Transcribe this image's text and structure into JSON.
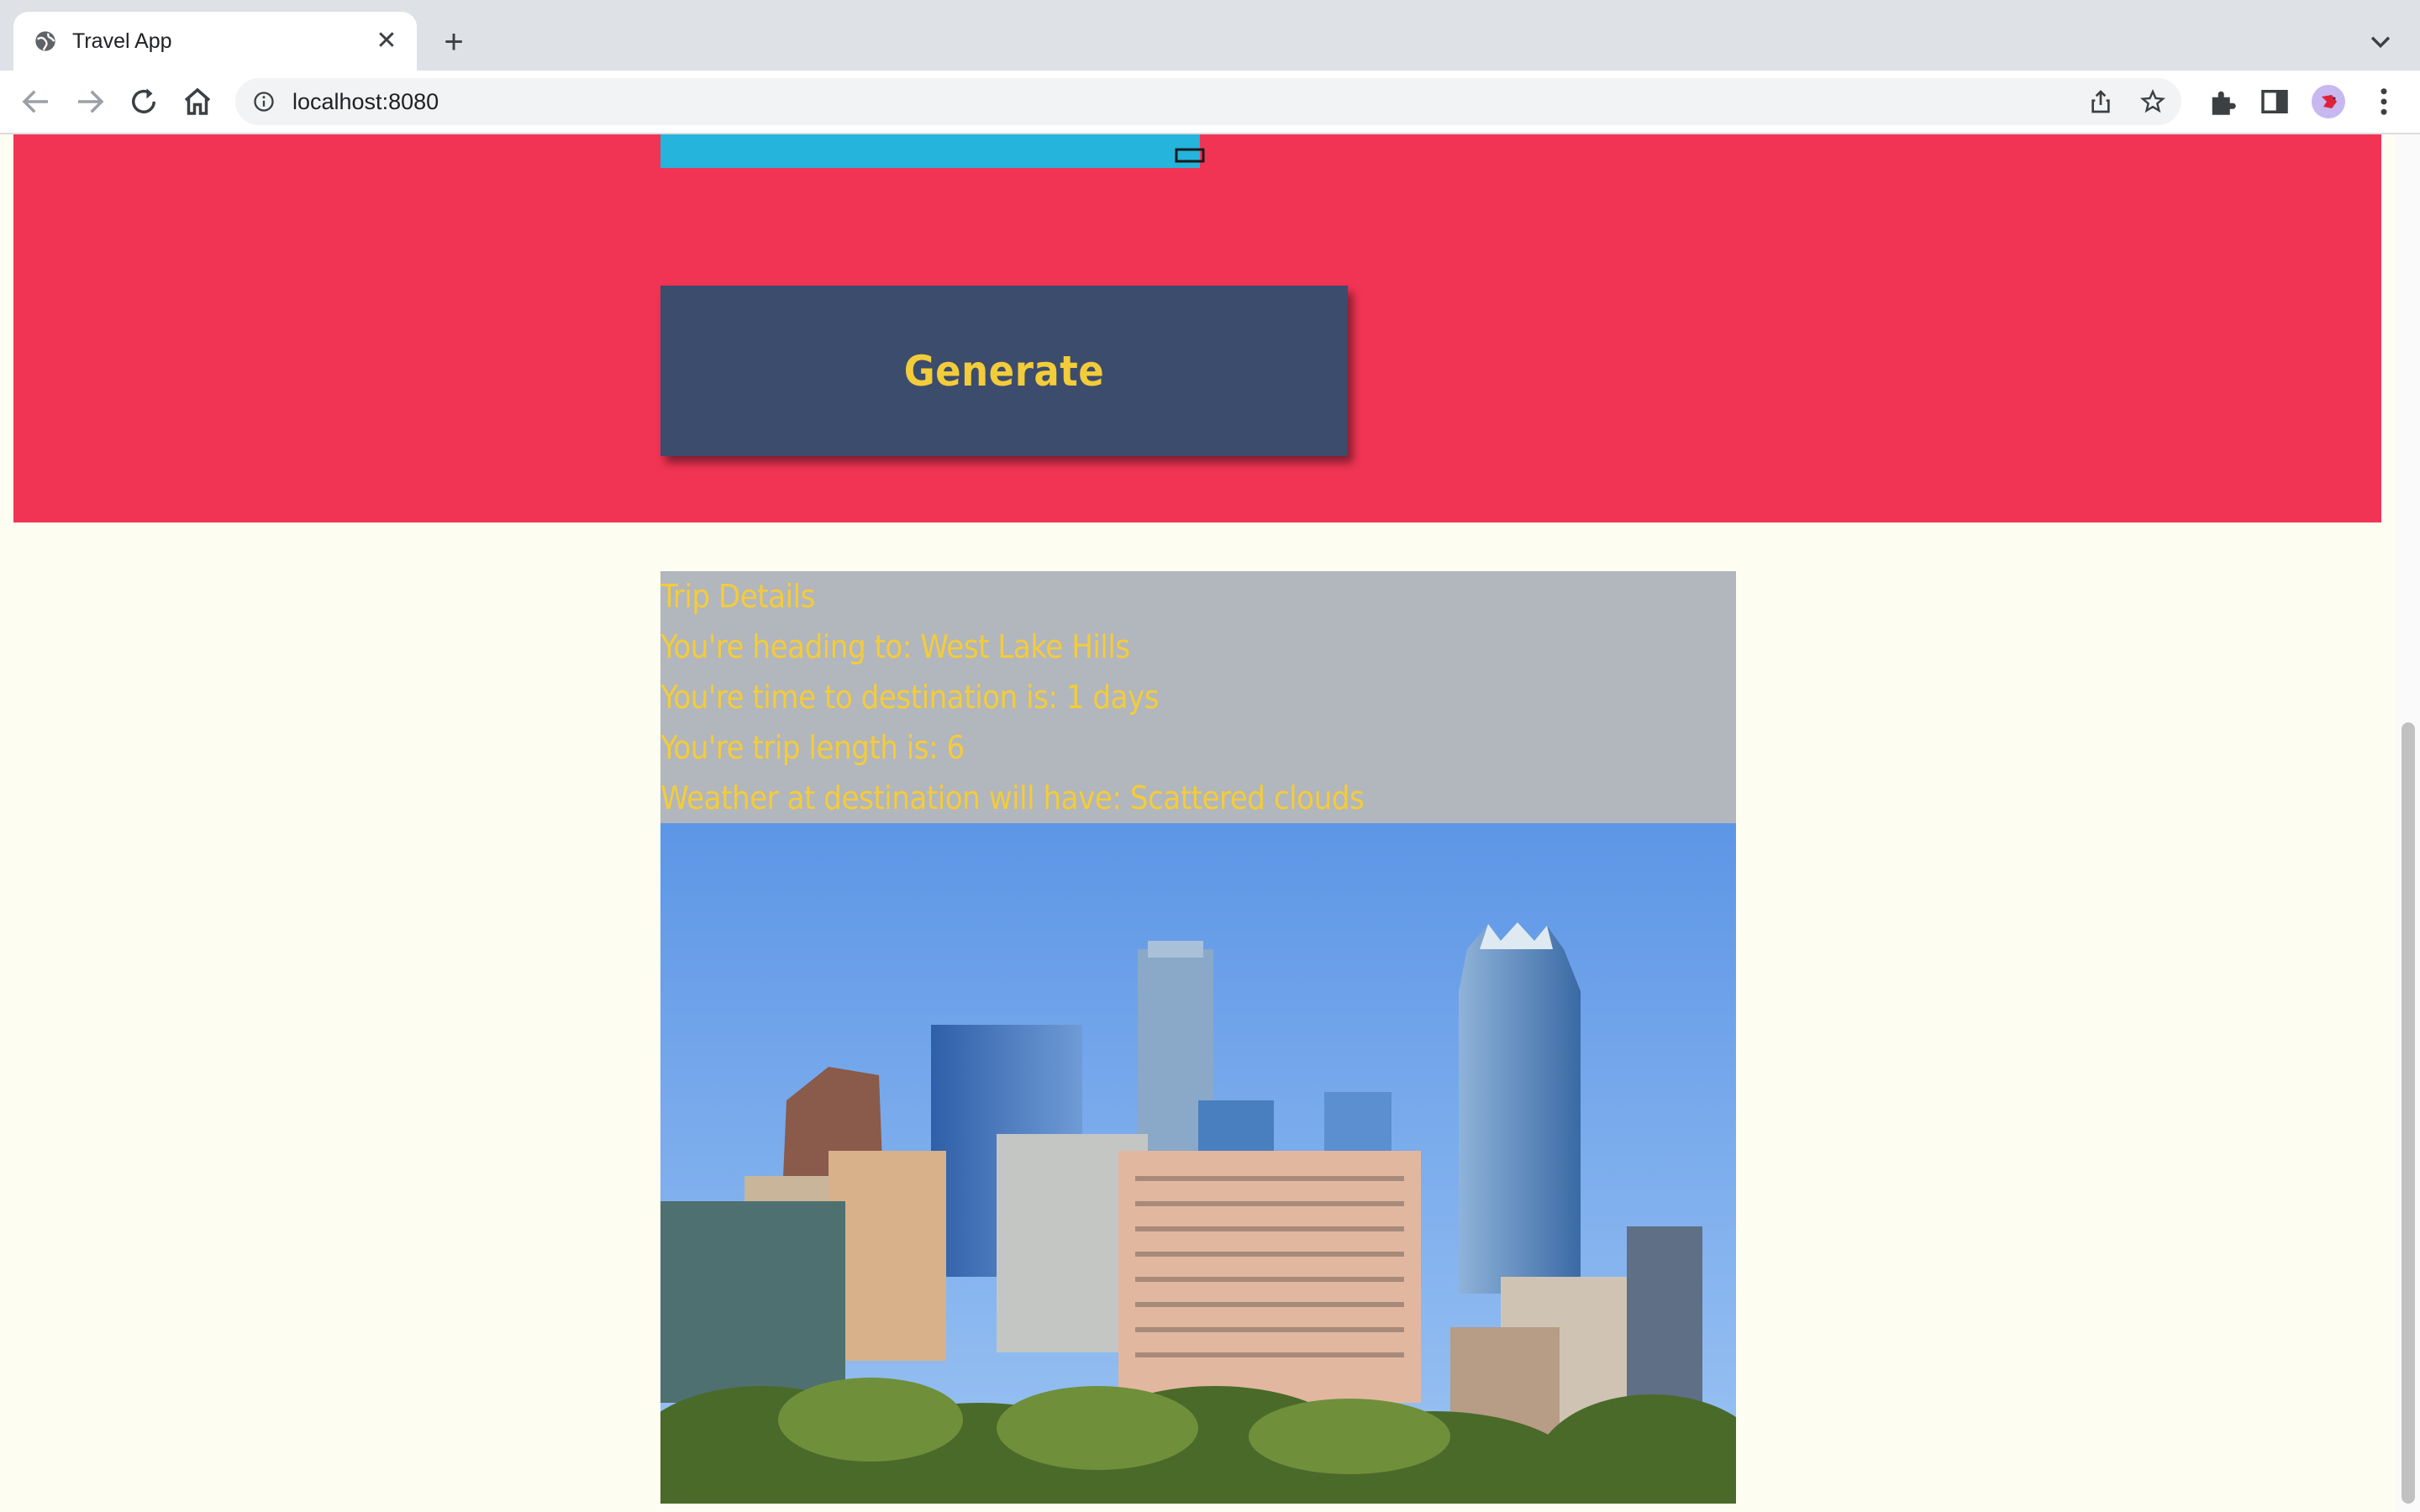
{
  "browser": {
    "tab_title": "Travel App",
    "url": "localhost:8080"
  },
  "page": {
    "generate_label": "Generate",
    "trip": {
      "title": "Trip Details",
      "heading_to": "You're heading to: West Lake Hills",
      "time_to_destination": "You're time to destination is: 1 days",
      "trip_length": "You're trip length is: 6",
      "weather": "Weather at destination will have: Scattered clouds"
    }
  },
  "colors": {
    "hero_bg": "#f23454",
    "button_bg": "#3c4c6c",
    "accent_text": "#f3cc3a",
    "panel_bg": "#b2b6bd",
    "page_bg": "#fefdf2",
    "input_bg": "#24b4dc"
  },
  "icons": [
    "globe-icon",
    "close-icon",
    "plus-icon",
    "chevron-down-icon",
    "back-icon",
    "forward-icon",
    "reload-icon",
    "home-icon",
    "info-icon",
    "share-icon",
    "star-icon",
    "extensions-icon",
    "side-panel-icon",
    "avatar",
    "kebab-menu-icon",
    "calendar-icon"
  ]
}
